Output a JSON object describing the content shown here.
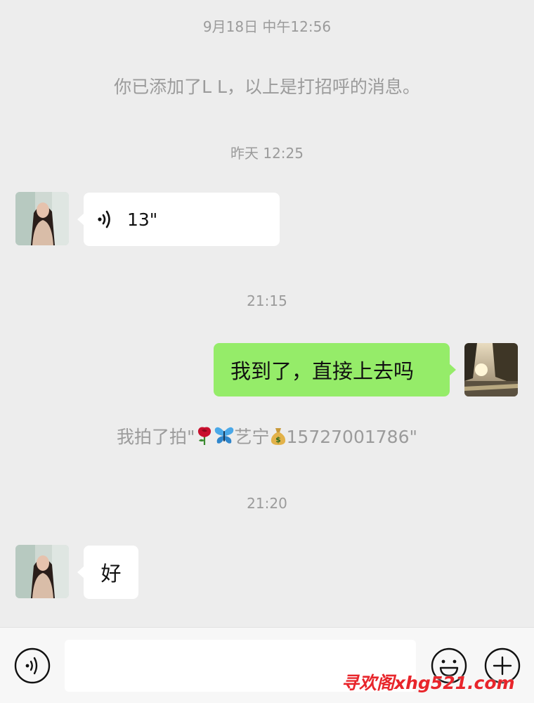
{
  "chat": {
    "timestamp_1": "9月18日 中午12:56",
    "notice_added": "你已添加了L L，以上是打招呼的消息。",
    "timestamp_2": "昨天 12:25",
    "voice_message_duration": "13\"",
    "timestamp_3": "21:15",
    "outgoing_message": "我到了，直接上去吗",
    "pat_notice_prefix": "我拍了拍\"",
    "pat_notice_name": "艺宁",
    "pat_notice_suffix": "15727001786\"",
    "timestamp_4": "21:20",
    "incoming_message": "好"
  },
  "icons": {
    "voice_wave": "voice-wave-icon",
    "rose": "rose-emoji",
    "butterfly": "butterfly-emoji",
    "money_bag": "money-bag-emoji",
    "voice_input": "voice-input-icon",
    "emoji": "emoji-icon",
    "more": "plus-icon"
  },
  "colors": {
    "background": "#ededed",
    "outgoing_bubble": "#95ec69",
    "incoming_bubble": "#ffffff",
    "system_text": "#9b9b9b",
    "watermark": "#e8252b"
  },
  "input": {
    "value": ""
  },
  "watermark": "寻欢阁xhg521.com"
}
